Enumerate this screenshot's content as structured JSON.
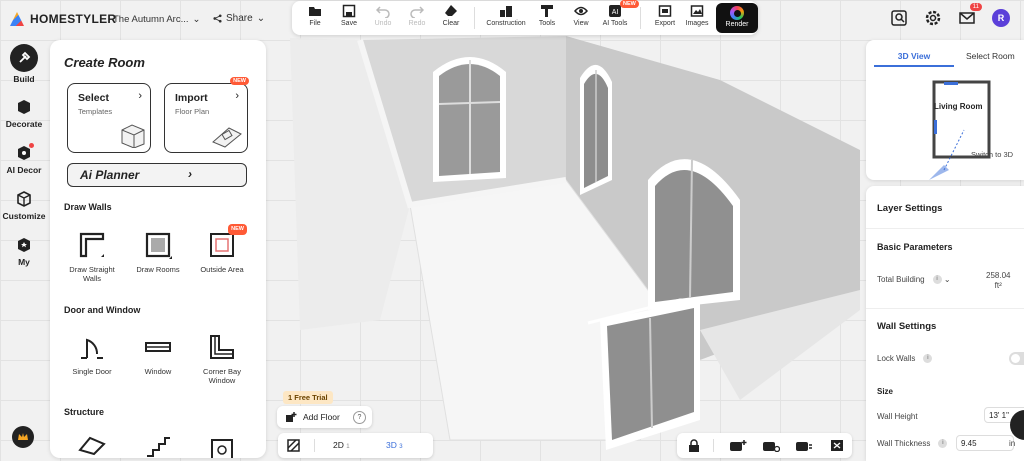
{
  "app": {
    "brand": "HOMESTYLER",
    "project_name": "The Autumn Arc...",
    "share_label": "Share"
  },
  "toolbar": {
    "file": "File",
    "save": "Save",
    "undo": "Undo",
    "redo": "Redo",
    "clear": "Clear",
    "construction": "Construction",
    "tools": "Tools",
    "view": "View",
    "ai_tools": "AI Tools",
    "ai_tools_badge": "NEW",
    "export": "Export",
    "images": "Images",
    "render": "Render"
  },
  "header": {
    "mail_count": "11",
    "avatar_letter": "R"
  },
  "rail": {
    "build": "Build",
    "decorate": "Decorate",
    "ai_decor": "AI Decor",
    "customize": "Customize",
    "my": "My"
  },
  "panel": {
    "title": "Create Room",
    "select_title": "Select",
    "select_sub": "Templates",
    "import_title": "Import",
    "import_sub": "Floor Plan",
    "import_badge": "NEW",
    "ai_planner": "Ai Planner",
    "draw_walls_heading": "Draw Walls",
    "draw_straight_walls": "Draw Straight Walls",
    "draw_rooms": "Draw Rooms",
    "outside_area": "Outside Area",
    "outside_area_badge": "NEW",
    "door_window_heading": "Door and Window",
    "single_door": "Single Door",
    "window": "Window",
    "corner_bay_window": "Corner Bay Window",
    "structure_heading": "Structure"
  },
  "bottom": {
    "trial": "1 Free Trial",
    "add_floor": "Add Floor",
    "help": "?",
    "view_2d": "2D",
    "view_2d_num": "1",
    "view_3d": "3D",
    "view_3d_num": "3"
  },
  "minimap": {
    "tab_3d": "3D View",
    "tab_select": "Select Room",
    "room_label": "Living Room",
    "switch": "Switch to 3D"
  },
  "props": {
    "layer_settings": "Layer Settings",
    "basic_params": "Basic Parameters",
    "total_building": "Total Building",
    "total_building_value": "258.04",
    "total_building_unit": "ft²",
    "wall_settings": "Wall Settings",
    "lock_walls": "Lock Walls",
    "size": "Size",
    "wall_height": "Wall Height",
    "wall_height_value": "13' 1\"",
    "wall_thickness": "Wall Thickness",
    "wall_thickness_value": "9.45",
    "wall_thickness_unit": "in"
  },
  "colors": {
    "accent": "#3b6fd9",
    "new_badge": "#ff5a36",
    "avatar": "#5b3fd9",
    "render_bg": "#111111"
  }
}
